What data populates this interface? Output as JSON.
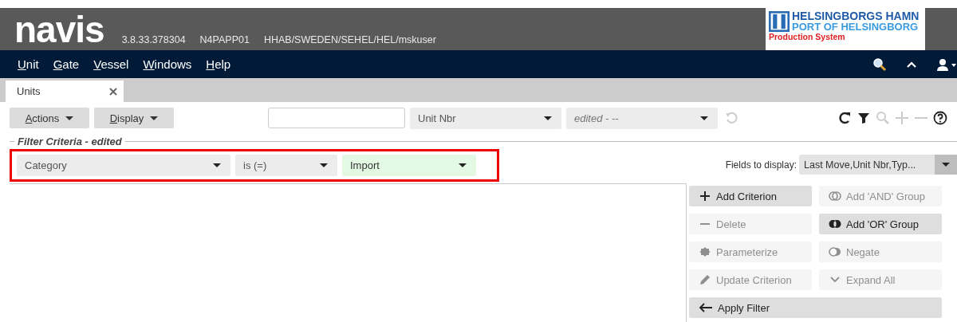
{
  "header": {
    "logo": "navis",
    "version": "3.8.33.378304",
    "server": "N4PAPP01",
    "scope": "HHAB/SWEDEN/SEHEL/HEL/mskuser",
    "brand": {
      "line1": "HELSINGBORGS HAMN",
      "line2": "PORT OF HELSINGBORG",
      "badge": "Production System"
    }
  },
  "menu": [
    "Unit",
    "Gate",
    "Vessel",
    "Windows",
    "Help"
  ],
  "tabs": [
    {
      "label": "Units",
      "selected": true
    }
  ],
  "toolbar": {
    "actions": "Actions",
    "display": "Display",
    "field": "Unit Nbr",
    "saved_filter": "edited - --",
    "icons": [
      {
        "kind": "refresh",
        "disabled": false
      },
      {
        "kind": "filter",
        "disabled": false
      },
      {
        "kind": "search",
        "disabled": true
      },
      {
        "kind": "plus",
        "disabled": true
      },
      {
        "kind": "minus",
        "disabled": true
      },
      {
        "kind": "help",
        "disabled": false
      }
    ]
  },
  "filter": {
    "legend": "Filter Criteria - edited",
    "criterion": {
      "field": "Category",
      "operator": "is (=)",
      "value": "Import"
    },
    "fields_label": "Fields to display:",
    "fields_value": "Last Move,Unit Nbr,Typ...",
    "buttons": [
      {
        "label": "Add Criterion",
        "kind": "plus",
        "disabled": false
      },
      {
        "label": "Add 'AND' Group",
        "kind": "and",
        "disabled": true
      },
      {
        "label": "Delete",
        "kind": "minus",
        "disabled": true
      },
      {
        "label": "Add 'OR' Group",
        "kind": "or",
        "disabled": false
      },
      {
        "label": "Parameterize",
        "kind": "gear",
        "disabled": true
      },
      {
        "label": "Negate",
        "kind": "negate",
        "disabled": true
      },
      {
        "label": "Update Criterion",
        "kind": "pencil",
        "disabled": true
      },
      {
        "label": "Expand All",
        "kind": "chevron",
        "disabled": true
      }
    ],
    "apply": {
      "label": "Apply Filter",
      "kind": "arrow",
      "disabled": false
    }
  }
}
